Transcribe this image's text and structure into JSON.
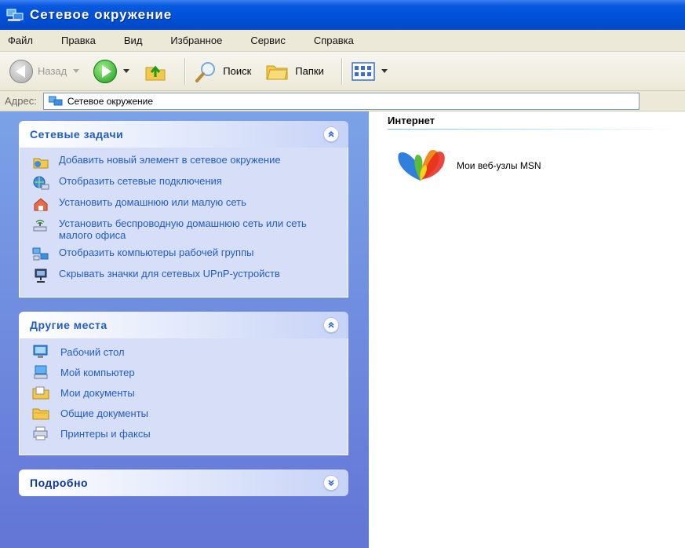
{
  "window": {
    "title": "Сетевое окружение"
  },
  "menu": [
    "Файл",
    "Правка",
    "Вид",
    "Избранное",
    "Сервис",
    "Справка"
  ],
  "toolbar": {
    "back_label": "Назад",
    "search_label": "Поиск",
    "folders_label": "Папки"
  },
  "address": {
    "label": "Адрес:",
    "value": "Сетевое окружение"
  },
  "network_tasks": {
    "title": "Сетевые задачи",
    "items": [
      "Добавить новый элемент в сетевое окружение",
      "Отобразить сетевые подключения",
      "Установить домашнюю или малую сеть",
      "Установить беспроводную домашнюю сеть или сеть малого офиса",
      "Отобразить компьютеры рабочей группы",
      "Скрывать значки для сетевых UPnP-устройств"
    ]
  },
  "other_places": {
    "title": "Другие места",
    "items": [
      "Рабочий стол",
      "Мой компьютер",
      "Мои документы",
      "Общие документы",
      "Принтеры и факсы"
    ]
  },
  "details": {
    "title": "Подробно"
  },
  "content": {
    "group_title": "Интернет",
    "items": [
      {
        "label": "Мои веб-узлы MSN",
        "icon": "msn-butterfly-icon"
      }
    ]
  },
  "colors": {
    "title_bar": "#0050d8",
    "task_pane": "#7ba2e7",
    "link_text": "#215dc6"
  }
}
